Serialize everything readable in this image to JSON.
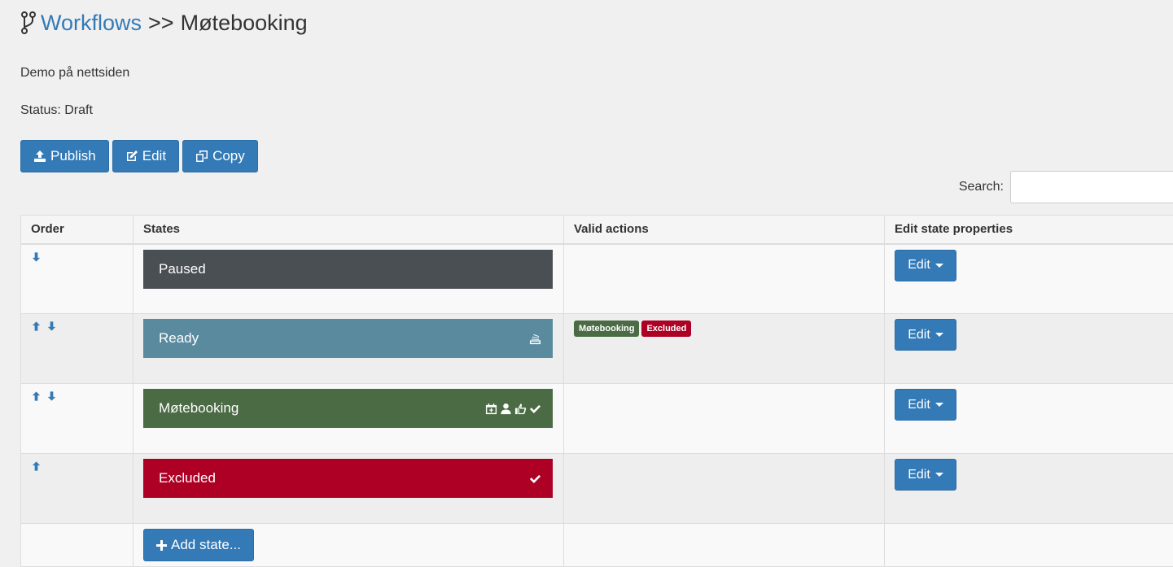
{
  "breadcrumb": {
    "root": "Workflows",
    "separator": ">>",
    "current": "Møtebooking"
  },
  "description": "Demo på nettsiden",
  "status_text": "Status: Draft",
  "toolbar": {
    "publish": "Publish",
    "edit": "Edit",
    "copy": "Copy"
  },
  "search": {
    "label": "Search:",
    "value": "",
    "placeholder": ""
  },
  "table": {
    "headers": {
      "order": "Order",
      "states": "States",
      "valid_actions": "Valid actions",
      "edit_props": "Edit state properties"
    },
    "rows": [
      {
        "name": "Paused",
        "color": "#4a4f54",
        "arrows": [
          "down"
        ],
        "icons": [],
        "actions": [],
        "edit": "Edit"
      },
      {
        "name": "Ready",
        "color": "#5a8a9e",
        "arrows": [
          "up",
          "down"
        ],
        "icons": [
          "stack-icon"
        ],
        "actions": [
          {
            "label": "Møtebooking",
            "color": "#4a6b44"
          },
          {
            "label": "Excluded",
            "color": "#ad0024"
          }
        ],
        "edit": "Edit"
      },
      {
        "name": "Møtebooking",
        "color": "#4a6b44",
        "arrows": [
          "up",
          "down"
        ],
        "icons": [
          "calendar-plus-icon",
          "user-icon",
          "thumbs-up-icon",
          "check-icon"
        ],
        "actions": [],
        "edit": "Edit"
      },
      {
        "name": "Excluded",
        "color": "#ad0024",
        "arrows": [
          "up"
        ],
        "icons": [
          "check-icon"
        ],
        "actions": [],
        "edit": "Edit"
      }
    ],
    "add_state": "Add state..."
  },
  "colors": {
    "primary": "#337ab7"
  }
}
